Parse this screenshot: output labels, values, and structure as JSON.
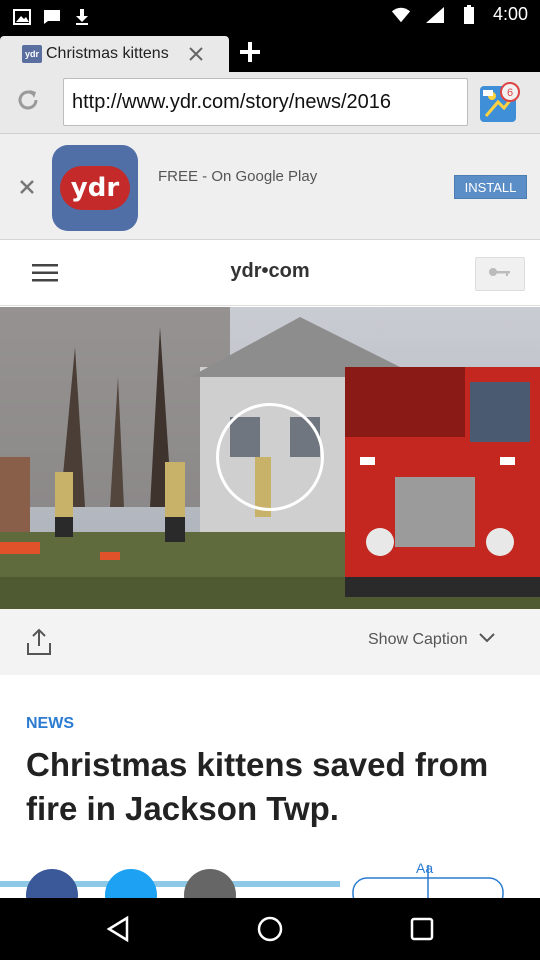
{
  "status_bar": {
    "time": "4:00",
    "left_icons": [
      "image-icon",
      "message-icon",
      "download-icon"
    ],
    "right_icons": [
      "wifi-icon",
      "signal-icon",
      "battery-icon"
    ]
  },
  "browser": {
    "tab": {
      "title": "Christmas kittens",
      "favicon": "ydr"
    },
    "url": "http://www.ydr.com/story/news/2016",
    "ad_badge_count": "6"
  },
  "app_banner": {
    "app_name": "ydr",
    "text": "FREE - On Google Play",
    "install_label": "INSTALL"
  },
  "site_header": {
    "logo": "ydr•com"
  },
  "caption_bar": {
    "show_caption_label": "Show Caption"
  },
  "article": {
    "section": "NEWS",
    "headline": "Christmas kittens saved from fire in Jackson Twp.",
    "text_size_label": "Aa"
  },
  "colors": {
    "accent_blue": "#2b7bd1",
    "install_button": "#5b8ec6",
    "ydr_red": "#c42a2a"
  }
}
